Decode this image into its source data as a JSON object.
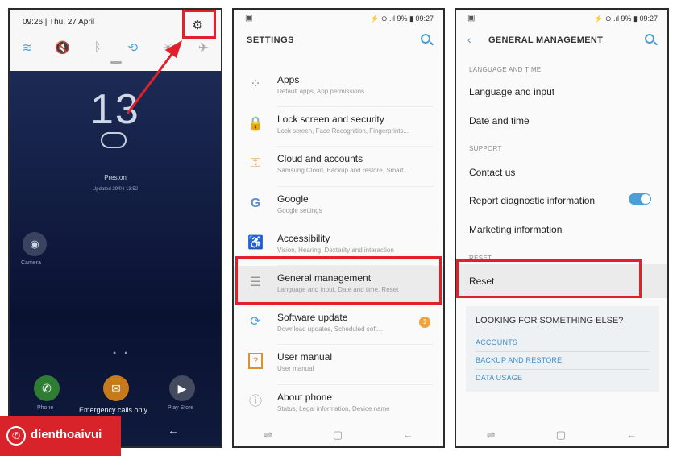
{
  "phone1": {
    "time_date": "09:26  |  Thu, 27 April",
    "quick_settings": [
      "wifi-icon",
      "mute-icon",
      "bluetooth-icon",
      "rotate-icon",
      "flashlight-icon",
      "airplane-icon"
    ],
    "clock": "13",
    "city": "Preston",
    "updated": "Updated 29/04 13:52",
    "camera_label": "Camera",
    "dock": [
      {
        "label": "Phone",
        "color": "#2e7d32",
        "glyph": "✆"
      },
      {
        "label": "Messages",
        "color": "#c67a1c",
        "glyph": "✉"
      },
      {
        "label": "Play Store",
        "color": "#444b5e",
        "glyph": "▶"
      }
    ],
    "emergency": "Emergency calls only"
  },
  "phone2": {
    "status_right": "⚡ ⊙ .ıl 9% ▮ 09:27",
    "title": "SETTINGS",
    "items": [
      {
        "title": "Apps",
        "subtitle": "Default apps, App permissions",
        "icon": "apps-icon",
        "glyph": "⁘"
      },
      {
        "title": "Lock screen and security",
        "subtitle": "Lock screen, Face Recognition, Fingerprints...",
        "icon": "lock-icon",
        "glyph": "🔒"
      },
      {
        "title": "Cloud and accounts",
        "subtitle": "Samsung Cloud, Backup and restore, Smart...",
        "icon": "key-icon",
        "glyph": "⚿"
      },
      {
        "title": "Google",
        "subtitle": "Google settings",
        "icon": "google-icon",
        "glyph": "G"
      },
      {
        "title": "Accessibility",
        "subtitle": "Vision, Hearing, Dexterity and interaction",
        "icon": "accessibility-icon",
        "glyph": "♿"
      },
      {
        "title": "General management",
        "subtitle": "Language and input, Date and time, Reset",
        "icon": "sliders-icon",
        "glyph": "☰"
      },
      {
        "title": "Software update",
        "subtitle": "Download updates, Scheduled soft...",
        "icon": "update-icon",
        "glyph": "⟳",
        "badge": "1"
      },
      {
        "title": "User manual",
        "subtitle": "User manual",
        "icon": "manual-icon",
        "glyph": "?"
      },
      {
        "title": "About phone",
        "subtitle": "Status, Legal information, Device name",
        "icon": "info-icon",
        "glyph": "ⓘ"
      }
    ]
  },
  "phone3": {
    "status_right": "⚡ ⊙ .ıl 9% ▮ 09:27",
    "title": "GENERAL MANAGEMENT",
    "section_language": "LANGUAGE AND TIME",
    "language_input": "Language and input",
    "date_time": "Date and time",
    "section_support": "SUPPORT",
    "contact_us": "Contact us",
    "report_diag": "Report diagnostic information",
    "marketing": "Marketing information",
    "section_reset": "RESET",
    "reset": "Reset",
    "card_heading": "LOOKING FOR SOMETHING ELSE?",
    "card_links": [
      "ACCOUNTS",
      "BACKUP AND RESTORE",
      "DATA USAGE"
    ]
  },
  "brand": {
    "name": "dienthoaivui"
  },
  "colors": {
    "highlight": "#e0202a",
    "accent": "#4a9fd8"
  }
}
